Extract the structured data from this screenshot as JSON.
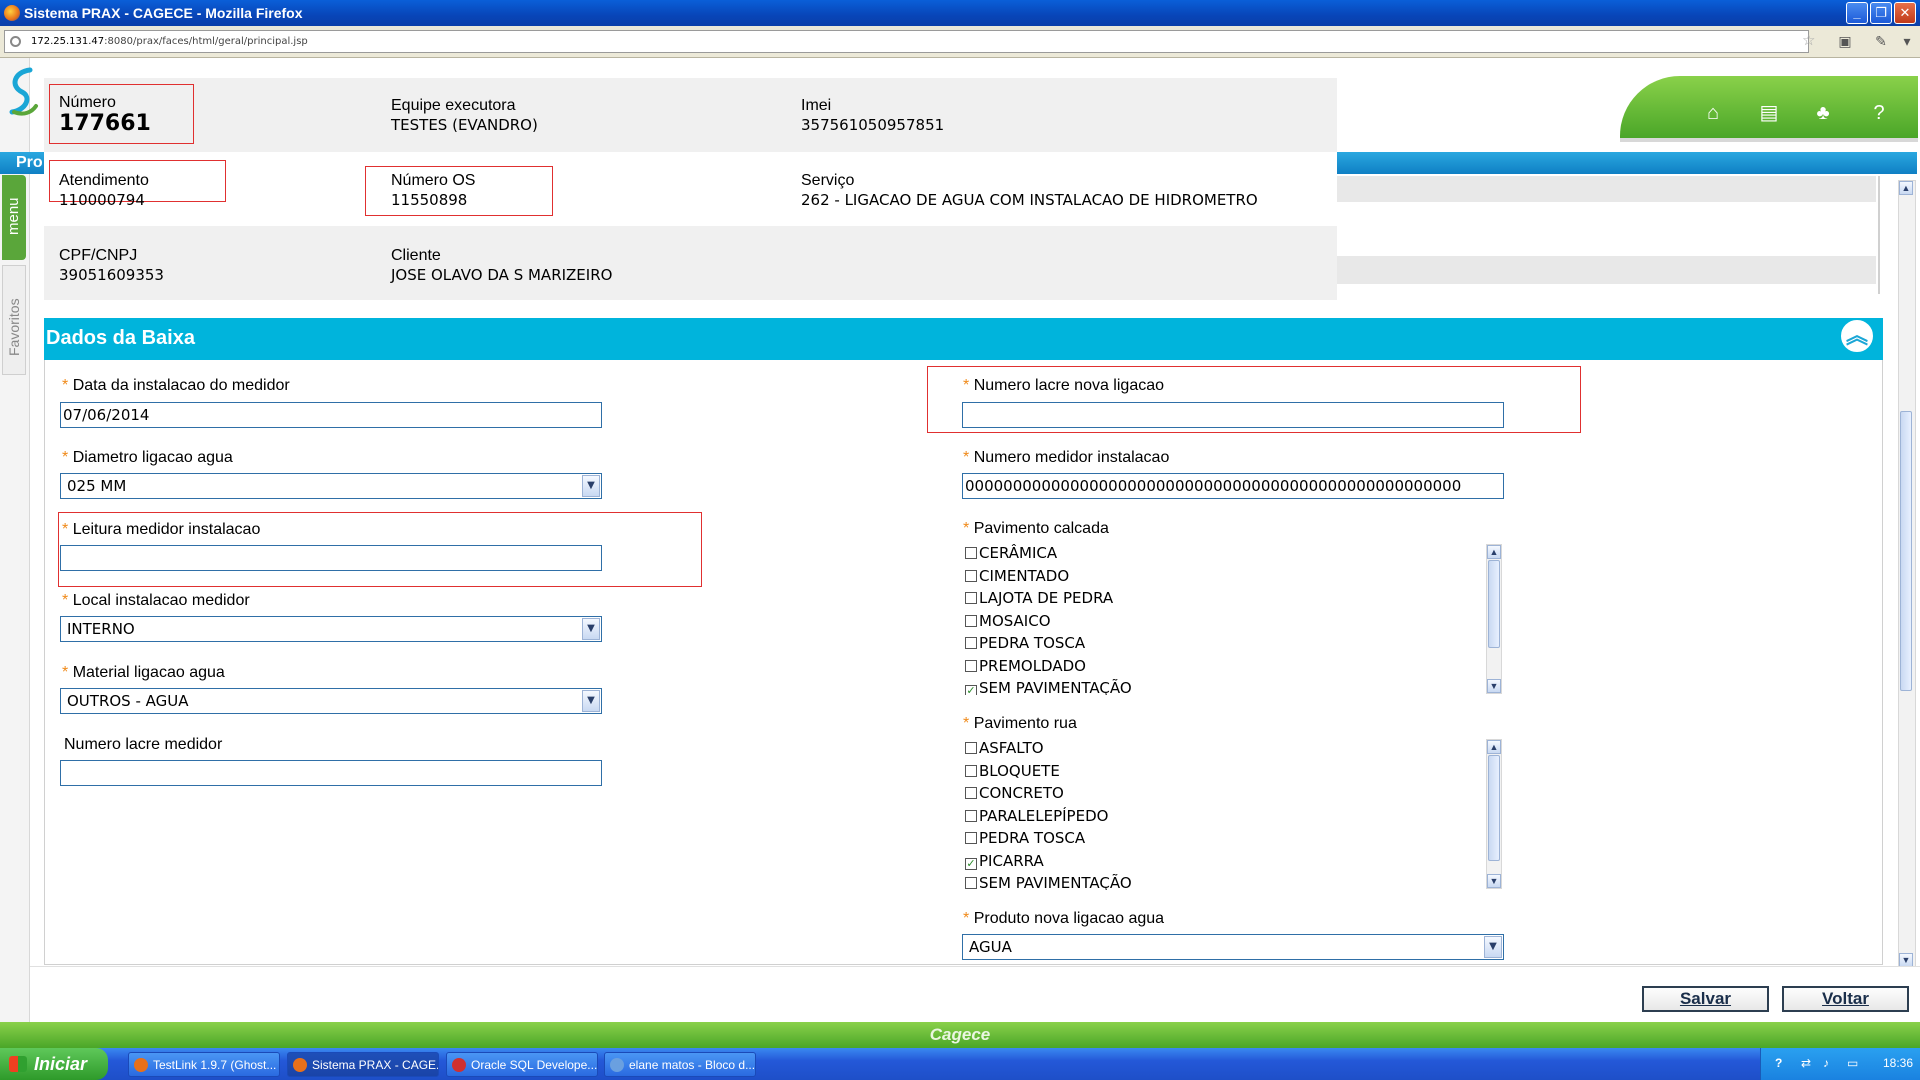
{
  "window": {
    "title": "Sistema PRAX - CAGECE - Mozilla Firefox",
    "url_host": "172.25.131.47",
    "url_path": ":8080/prax/faces/html/geral/principal.jsp"
  },
  "app": {
    "menu_tab": "menu",
    "favoritos_tab": "Favoritos",
    "pro_tab": "Pro"
  },
  "info": {
    "numero_label": "Número",
    "numero_value": "177661",
    "equipe_label": "Equipe executora",
    "equipe_value": "TESTES (EVANDRO)",
    "imei_label": "Imei",
    "imei_value": "357561050957851",
    "atendimento_label": "Atendimento",
    "atendimento_value": "110000794",
    "numero_os_label": "Número OS",
    "numero_os_value": "11550898",
    "servico_label": "Serviço",
    "servico_value": "262 - LIGACAO DE AGUA COM INSTALACAO DE HIDROMETRO",
    "cpf_label": "CPF/CNPJ",
    "cpf_value": "39051609353",
    "cliente_label": "Cliente",
    "cliente_value": "JOSE OLAVO DA S MARIZEIRO"
  },
  "section": {
    "title": "Dados da Baixa"
  },
  "form_left": {
    "data_instalacao_label": "Data da instalacao do medidor",
    "data_instalacao_value": "07/06/2014",
    "diametro_label": "Diametro ligacao agua",
    "diametro_value": "025 MM",
    "leitura_label": "Leitura medidor instalacao",
    "leitura_value": "",
    "local_label": "Local instalacao medidor",
    "local_value": "INTERNO",
    "material_label": "Material ligacao agua",
    "material_value": "OUTROS - AGUA",
    "lacre_medidor_label": "Numero lacre medidor",
    "lacre_medidor_value": ""
  },
  "form_right": {
    "lacre_nova_label": "Numero lacre nova ligacao",
    "lacre_nova_value": "",
    "medidor_instalacao_label": "Numero medidor instalacao",
    "medidor_instalacao_value": "0000000000000000000000000000000000000000000000000000",
    "pavimento_calcada_label": "Pavimento calcada",
    "pavimento_calcada_items": [
      "CERÂMICA",
      "CIMENTADO",
      "LAJOTA DE PEDRA",
      "MOSAICO",
      "PEDRA TOSCA",
      "PREMOLDADO",
      "SEM PAVIMENTAÇÃO"
    ],
    "pavimento_calcada_checked": [
      false,
      false,
      false,
      false,
      false,
      false,
      true
    ],
    "pavimento_rua_label": "Pavimento rua",
    "pavimento_rua_items": [
      "ASFALTO",
      "BLOQUETE",
      "CONCRETO",
      "PARALELEPÍPEDO",
      "PEDRA TOSCA",
      "PICARRA",
      "SEM PAVIMENTAÇÃO"
    ],
    "pavimento_rua_checked": [
      false,
      false,
      false,
      false,
      false,
      true,
      false
    ],
    "produto_label": "Produto nova ligacao agua",
    "produto_value": "AGUA"
  },
  "buttons": {
    "salvar": "Salvar",
    "voltar": "Voltar"
  },
  "footer": {
    "brand": "Cagece"
  },
  "taskbar": {
    "start": "Iniciar",
    "tasks": [
      "TestLink 1.9.7 (Ghost...",
      "Sistema PRAX - CAGE...",
      "Oracle SQL Develope...",
      "elane matos - Bloco d..."
    ],
    "clock": "18:36"
  },
  "colors": {
    "accent_blue": "#00b4dc",
    "brand_green": "#5aa63a",
    "required_star": "#f08a1a",
    "highlight_red": "#e03030"
  }
}
